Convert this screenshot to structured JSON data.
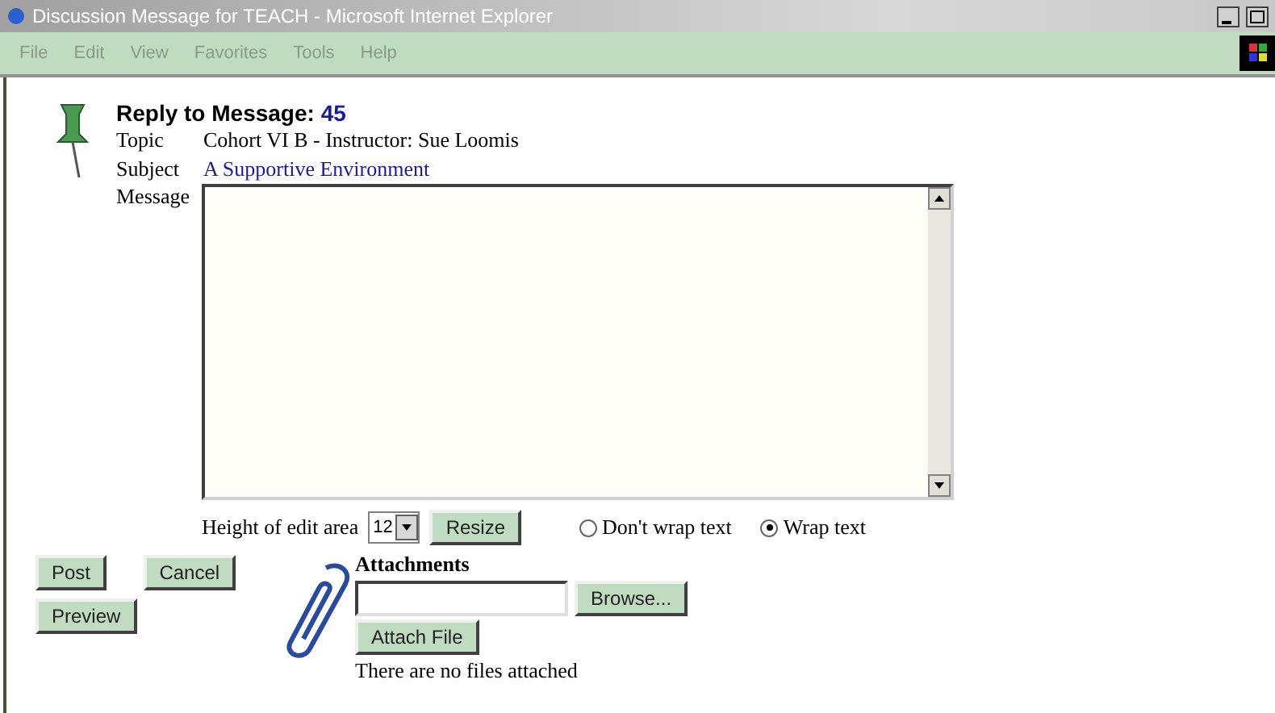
{
  "window": {
    "title": "Discussion Message for TEACH - Microsoft Internet Explorer"
  },
  "menu": [
    "File",
    "Edit",
    "View",
    "Favorites",
    "Tools",
    "Help"
  ],
  "heading": {
    "label": "Reply to Message:",
    "number": "45"
  },
  "topic": {
    "label": "Topic",
    "value": "Cohort VI B - Instructor: Sue Loomis"
  },
  "subject": {
    "label": "Subject",
    "value": "A Supportive Environment"
  },
  "message": {
    "label": "Message"
  },
  "edit_height": {
    "label": "Height of edit area",
    "value": "12",
    "button": "Resize"
  },
  "wrap_options": [
    {
      "label": "Don't wrap text",
      "selected": false
    },
    {
      "label": "Wrap text",
      "selected": true
    }
  ],
  "actions": [
    "Post",
    "Cancel",
    "Preview"
  ],
  "attachments": {
    "title": "Attachments",
    "browse": "Browse...",
    "attach": "Attach File",
    "status": "There are no files attached"
  }
}
